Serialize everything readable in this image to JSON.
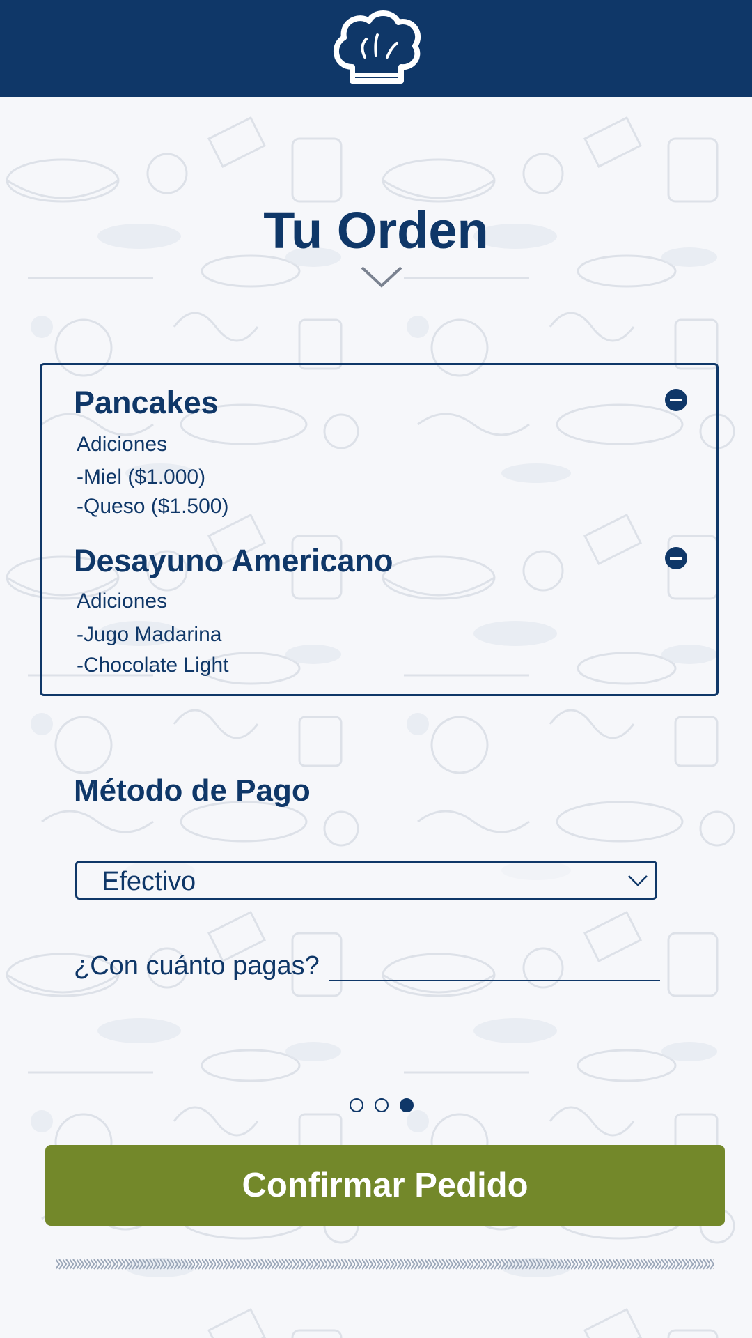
{
  "header": {
    "logo_icon": "chef-hat-icon"
  },
  "page": {
    "title": "Tu Orden"
  },
  "order": {
    "items": [
      {
        "name": "Pancakes",
        "additions_label": "Adiciones",
        "additions": [
          "-Miel ($1.000)",
          "-Queso ($1.500)"
        ]
      },
      {
        "name": "Desayuno Americano",
        "additions_label": "Adiciones",
        "additions": [
          "-Jugo Madarina",
          "-Chocolate Light"
        ]
      }
    ]
  },
  "payment": {
    "title": "Método de Pago",
    "selected": "Efectivo",
    "cash_label": "¿Con cuánto pagas?",
    "cash_value": ""
  },
  "pagination": {
    "total": 3,
    "current": 3
  },
  "confirm_label": "Confirmar Pedido",
  "colors": {
    "primary": "#0f3768",
    "accent": "#73882a",
    "background": "#f6f7fa"
  }
}
